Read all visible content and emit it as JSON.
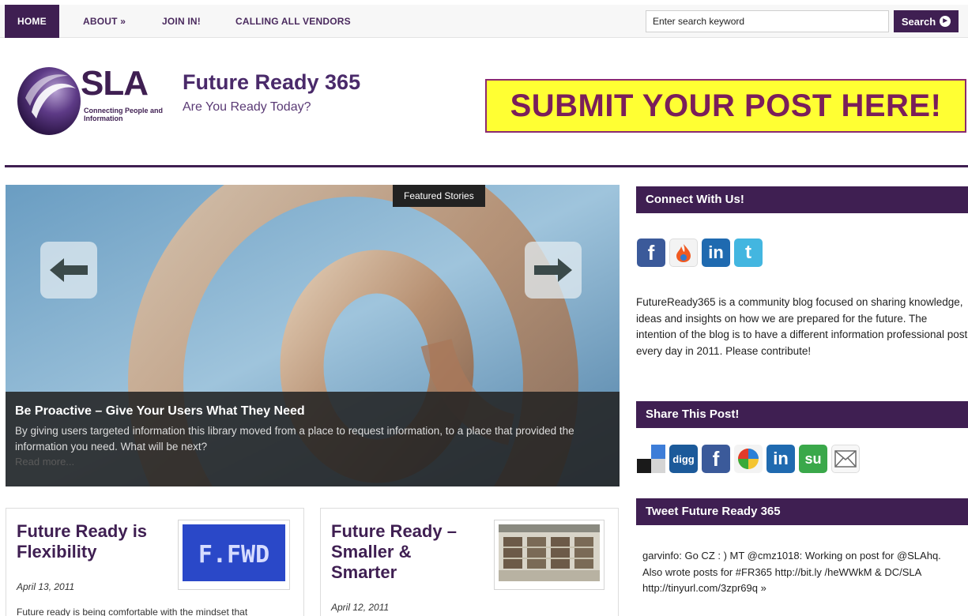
{
  "nav": {
    "items": [
      {
        "label": "HOME"
      },
      {
        "label": "ABOUT »"
      },
      {
        "label": "JOIN IN!"
      },
      {
        "label": "CALLING ALL VENDORS"
      }
    ],
    "search_placeholder": "Enter search keyword",
    "search_button": "Search"
  },
  "header": {
    "logo_text": "SLA",
    "logo_tagline": "Connecting People and Information",
    "title": "Future Ready 365",
    "tagline": "Are You Ready Today?",
    "banner": "SUBMIT YOUR POST HERE!"
  },
  "slider": {
    "tag": "Featured Stories",
    "title": "Be Proactive – Give Your Users What They Need",
    "text": "By giving users targeted information this library moved from a place to request information, to a place that provided the information you need. What will be next?",
    "more": "Read more..."
  },
  "posts": [
    {
      "title": "Future Ready is Flexibility",
      "date": "April 13, 2011",
      "excerpt": "Future ready is being comfortable with the mindset that",
      "thumb_text": "F.FWD"
    },
    {
      "title": "Future Ready – Smaller & Smarter",
      "date": "April 12, 2011"
    }
  ],
  "sidebar": {
    "connect_title": "Connect With Us!",
    "about": "FutureReady365 is a community blog focused on sharing knowledge, ideas and insights on how we are prepared for the future. The intention of the blog is to have a different information professional post every day in 2011. Please contribute!",
    "share_title": "Share This Post!",
    "tweet_title": "Tweet Future Ready 365",
    "tweet": "garvinfo: Go CZ : ) MT @cmz1018: Working on post for @SLAhq. Also wrote posts for #FR365 http://bit.ly /heWWkM & DC/SLA http://tinyurl.com/3zpr69q »",
    "share_digg": "digg"
  },
  "colors": {
    "brand": "#3f1f52",
    "banner_bg": "#ffff33",
    "banner_text": "#7a1e5a"
  }
}
